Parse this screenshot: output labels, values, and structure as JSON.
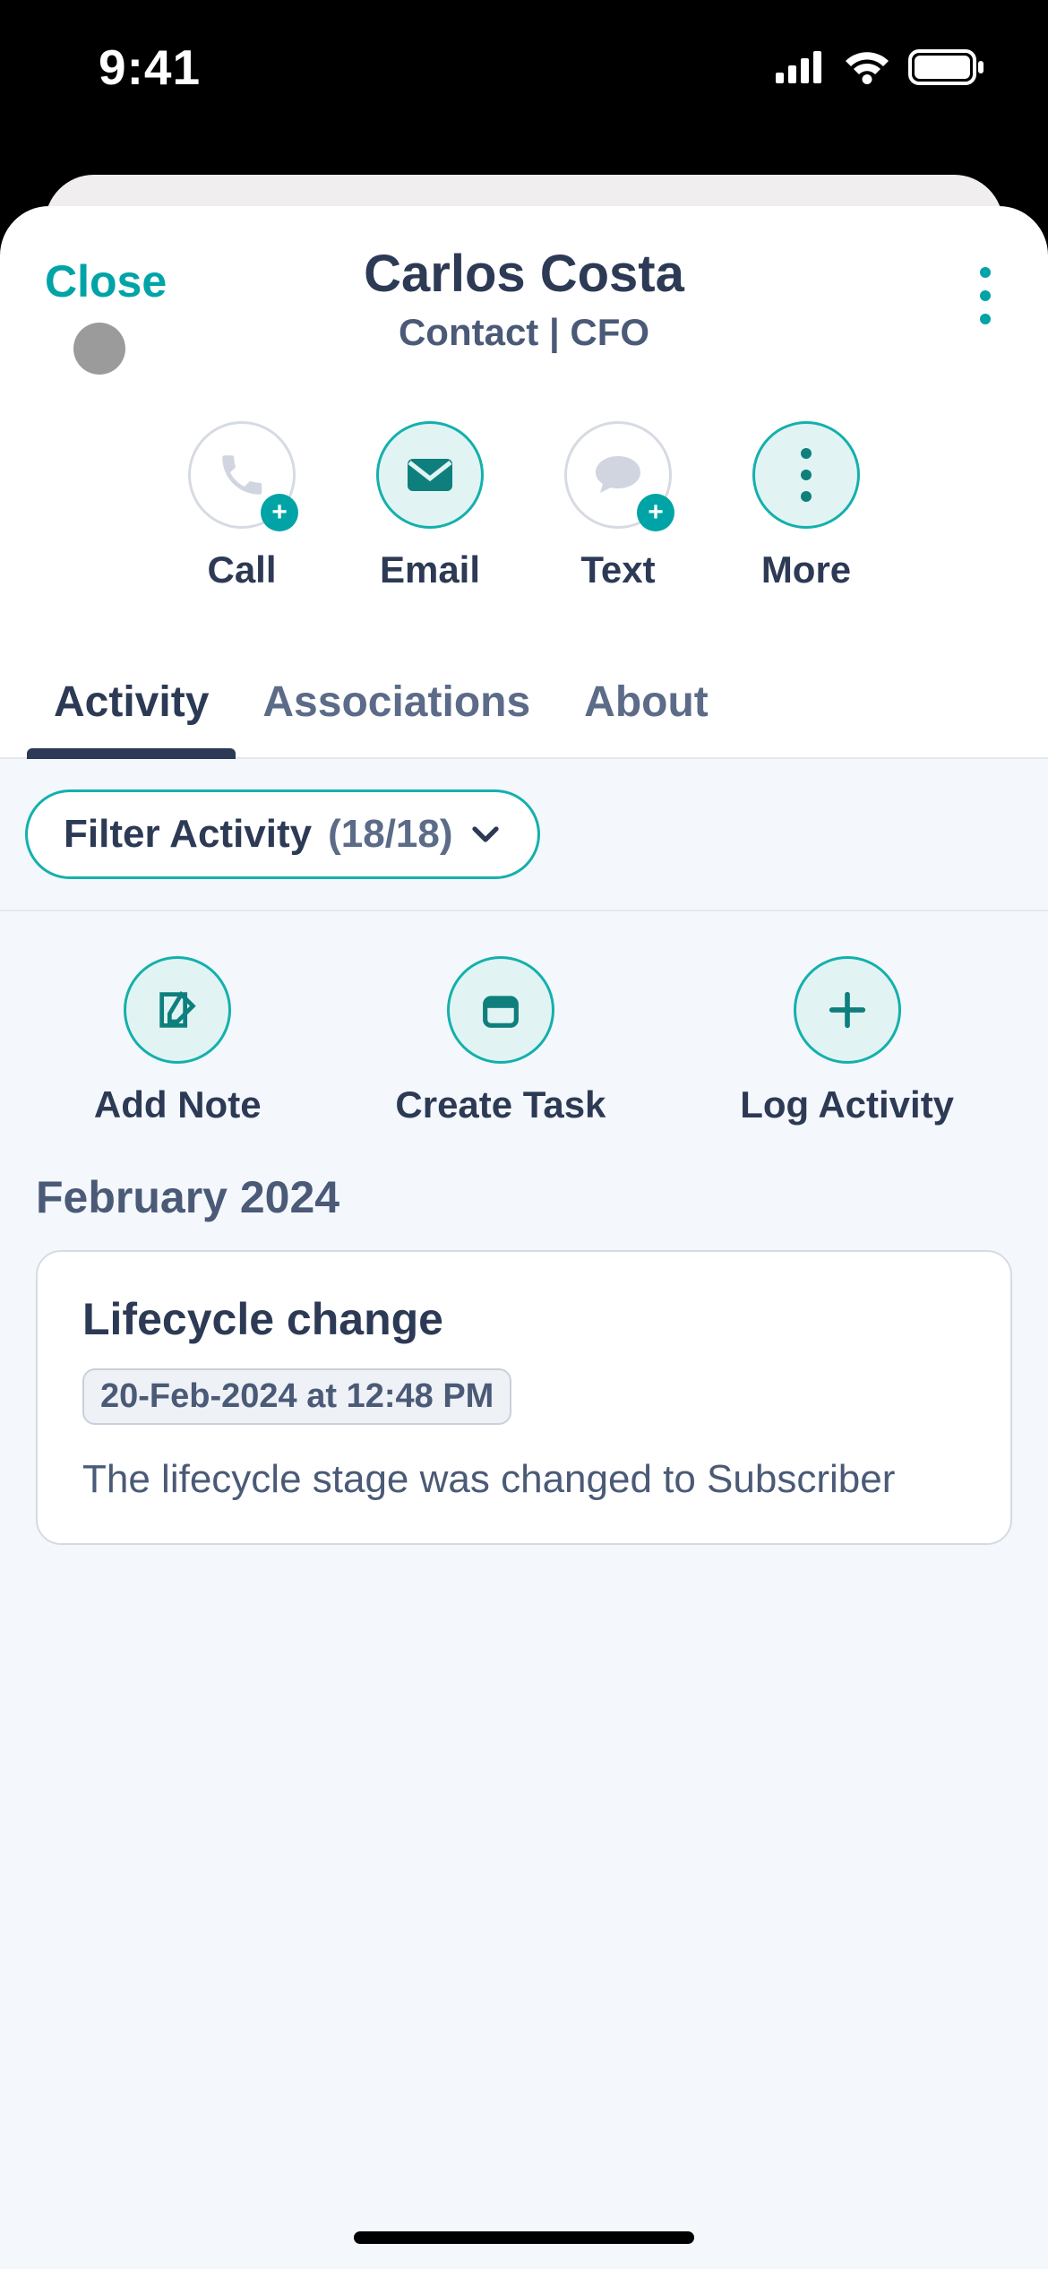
{
  "status": {
    "time": "9:41"
  },
  "header": {
    "close_label": "Close",
    "title": "Carlos Costa",
    "subtitle": "Contact | CFO"
  },
  "quick_actions": {
    "call": "Call",
    "email": "Email",
    "text": "Text",
    "more": "More"
  },
  "tabs": {
    "activity": "Activity",
    "associations": "Associations",
    "about": "About"
  },
  "filter": {
    "label": "Filter Activity",
    "count": "(18/18)"
  },
  "activity_actions": {
    "add_note": "Add Note",
    "create_task": "Create Task",
    "log_activity": "Log Activity"
  },
  "timeline": {
    "month": "February 2024",
    "entry": {
      "title": "Lifecycle change",
      "timestamp": "20-Feb-2024 at 12:48 PM",
      "body": "The lifecycle stage was changed to Subscriber"
    }
  }
}
